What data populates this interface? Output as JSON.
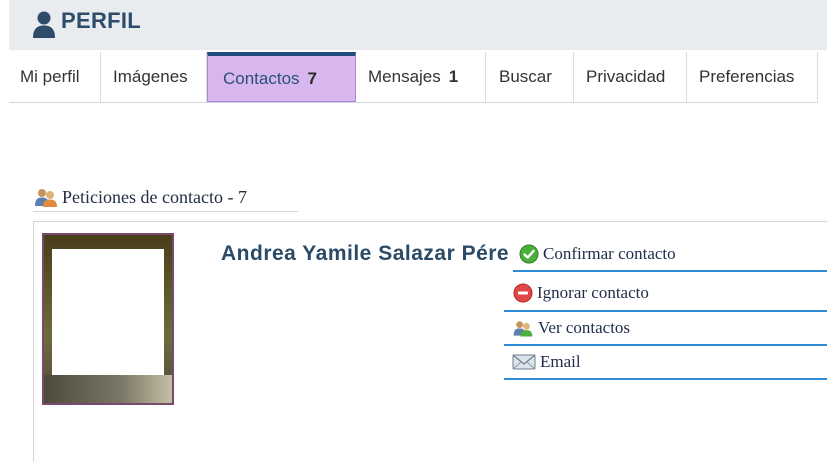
{
  "header": {
    "title": "PERFIL",
    "icon": "user-icon"
  },
  "tabs": [
    {
      "label": "Mi perfil",
      "count": ""
    },
    {
      "label": "Imágenes",
      "count": ""
    },
    {
      "label": "Contactos",
      "count": "7",
      "active": true
    },
    {
      "label": "Mensajes",
      "count": "1"
    },
    {
      "label": "Buscar",
      "count": ""
    },
    {
      "label": "Privacidad",
      "count": ""
    },
    {
      "label": "Preferencias",
      "count": ""
    }
  ],
  "section": {
    "title": "Peticiones de contacto - 7",
    "icon": "contacts-icon"
  },
  "contact": {
    "name": "Andrea Yamile Salazar Pérez"
  },
  "actions": [
    {
      "label": "Confirmar contacto",
      "icon": "check-icon"
    },
    {
      "label": "Ignorar contacto",
      "icon": "minus-icon"
    },
    {
      "label": "Ver contactos",
      "icon": "contacts-icon"
    },
    {
      "label": "Email",
      "icon": "envelope-icon"
    }
  ],
  "colors": {
    "active_tab_bg": "#d8b7ee",
    "active_tab_top": "#1f4c7a",
    "header_bg": "#e8ecef",
    "action_divider": "#2c8ad6"
  }
}
